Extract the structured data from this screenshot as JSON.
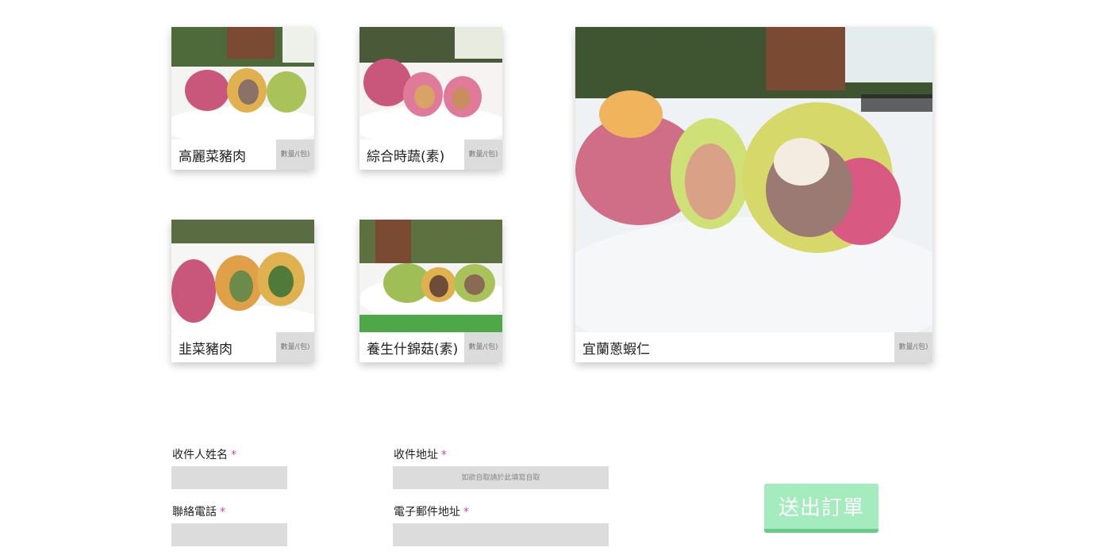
{
  "products": [
    {
      "name": "高麗菜豬肉",
      "qty_placeholder": "數量/(包)"
    },
    {
      "name": "綜合時蔬(素)",
      "qty_placeholder": "數量/(包)"
    },
    {
      "name": "韭菜豬肉",
      "qty_placeholder": "數量/(包)"
    },
    {
      "name": "養生什錦菇(素)",
      "qty_placeholder": "數量/(包)"
    },
    {
      "name": "宜蘭蔥蝦仁",
      "qty_placeholder": "數量/(包)"
    }
  ],
  "form": {
    "name_label": "收件人姓名",
    "address_label": "收件地址",
    "address_placeholder": "如欲自取請於此填寫自取",
    "phone_label": "聯絡電話",
    "email_label": "電子郵件地址",
    "required_mark": "*",
    "submit_label": "送出訂單"
  },
  "colors": {
    "submit_bg": "#a4ecbe",
    "submit_border": "#66cc88",
    "required": "#e0409a",
    "input_bg": "#dcdcdc"
  }
}
